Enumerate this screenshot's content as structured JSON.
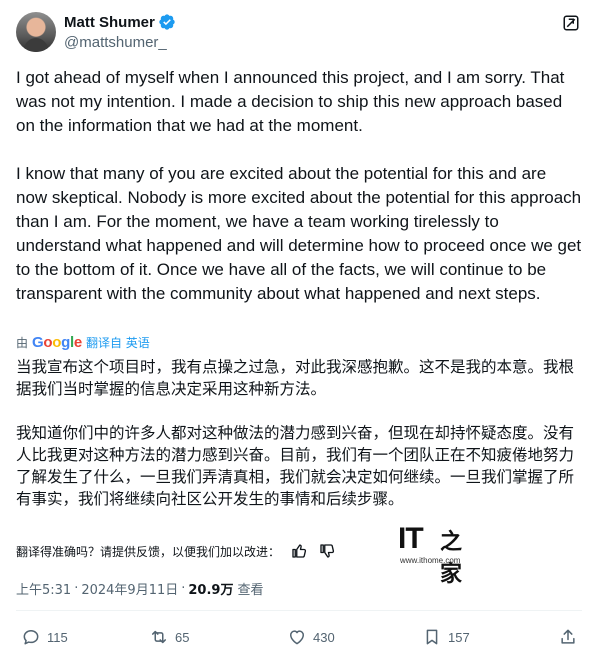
{
  "author": {
    "display_name": "Matt Shumer",
    "handle": "@mattshumer_"
  },
  "tweet": {
    "paragraphs": [
      "I got ahead of myself when I announced this project, and I am sorry. That was not my intention. I made a decision to ship this new approach based on the information that we had at the moment.",
      "I know that many of you are excited about the potential for this and are now skeptical. Nobody is more excited about the potential for this approach than I am. For the moment, we have a team working tirelessly to understand what happened and will determine how to proceed once we get to the bottom of it. Once we have all of the facts, we will continue to be transparent with the community about what happened and next steps."
    ]
  },
  "translation": {
    "by_label": "由",
    "google_logo_text": "Google",
    "link_label": "翻译自 英语",
    "paragraphs": [
      "当我宣布这个项目时，我有点操之过急，对此我深感抱歉。这不是我的本意。我根据我们当时掌握的信息决定采用这种新方法。",
      "我知道你们中的许多人都对这种做法的潜力感到兴奋，但现在却持怀疑态度。没有人比我更对这种方法的潜力感到兴奋。目前，我们有一个团队正在不知疲倦地努力了解发生了什么，一旦我们弄清真相，我们就会决定如何继续。一旦我们掌握了所有事实，我们将继续向社区公开发生的事情和后续步骤。"
    ],
    "feedback_prompt": "翻译得准确吗？请提供反馈，以便我们加以改进："
  },
  "watermark": {
    "brand": "IT",
    "char": "之家",
    "url": "www.ithome.com"
  },
  "meta": {
    "time": "上午5:31",
    "separator": "·",
    "date": "2024年9月11日",
    "views": "20.9万",
    "views_label": "查看"
  },
  "actions": {
    "replies": "115",
    "retweets": "65",
    "likes": "430",
    "bookmarks": "157"
  },
  "colors": {
    "text": "#0f1419",
    "secondary": "#536471",
    "accent": "#1d9bf0",
    "divider": "#eff3f4"
  },
  "icons": [
    "verified-badge-icon",
    "grok-icon",
    "thumbs-up-icon",
    "thumbs-down-icon",
    "reply-icon",
    "retweet-icon",
    "like-icon",
    "bookmark-icon",
    "share-icon"
  ]
}
